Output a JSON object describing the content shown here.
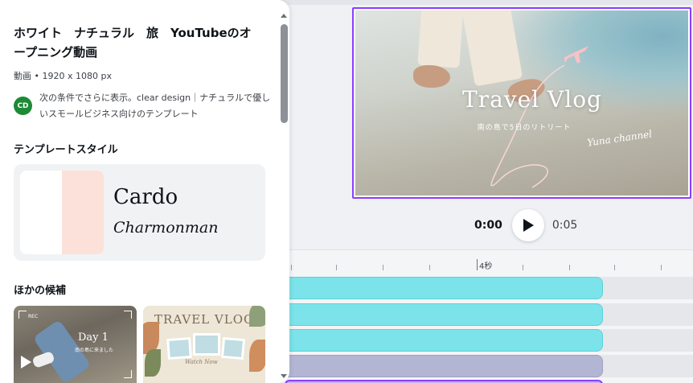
{
  "panel": {
    "title": "ホワイト　ナチュラル　旅　YouTubeのオープニング動画",
    "meta": "動画 • 1920 x 1080 px",
    "creator": {
      "avatar_initials": "CD",
      "text": "次の条件でさらに表示。clear design｜ナチュラルで優しいスモールビジネス向けのテンプレート"
    },
    "style_section_title": "テンプレートスタイル",
    "style_card": {
      "font_primary": "Cardo",
      "font_secondary": "Charmonman",
      "swatch_colors": [
        "#ffffff",
        "#fce1da"
      ]
    },
    "alternatives_title": "ほかの候補",
    "alternatives": [
      {
        "title": "Day 1",
        "subtitle": "南の島に来ました",
        "rec_label": "REC"
      },
      {
        "title": "TRAVEL VLOG",
        "subtitle": "Watch Now"
      }
    ]
  },
  "preview": {
    "title": "Travel Vlog",
    "subtitle": "南の島で5日のリトリート",
    "channel": "Yuna channel",
    "selection_color": "#8b3dff"
  },
  "playback": {
    "current_time": "0:00",
    "total_time": "0:05",
    "play_icon": "play-icon"
  },
  "timeline": {
    "ruler_label": "4秒",
    "track_colors": [
      "#7de3ea",
      "#7de3ea",
      "#7de3ea",
      "#b3b6d3"
    ]
  }
}
